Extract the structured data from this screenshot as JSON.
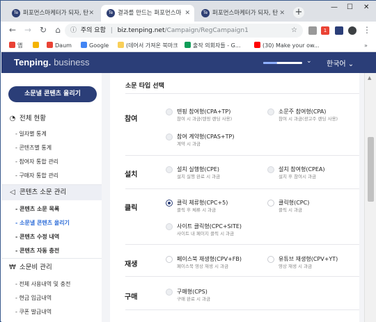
{
  "browser": {
    "tabs": [
      {
        "title": "퍼포먼스마케터가 되자, 탄",
        "fav": "Te"
      },
      {
        "title": "결과를 만드는 퍼포먼스마",
        "fav": "Te"
      },
      {
        "title": "퍼포먼스마케터가 되자, 탄",
        "fav": "Te"
      }
    ],
    "security_label": "주의 요함",
    "url_host": "biz.tenping.net",
    "url_path": "/Campaign/RegCampaign1",
    "bookmarks": [
      {
        "label": "앱",
        "color": "#e94235"
      },
      {
        "label": "",
        "color": "#f4b400"
      },
      {
        "label": "Daum",
        "color": "#ea4335"
      },
      {
        "label": "Google",
        "color": "#4285f4"
      },
      {
        "label": "(데어서 가져온 북마크",
        "color": "#f9cf58"
      },
      {
        "label": "출작 의회자들 - G...",
        "color": "#0f9d58"
      },
      {
        "label": "(30) Make your ow...",
        "color": "#ff0000"
      }
    ]
  },
  "header": {
    "logo": "Tenping.",
    "logo_suffix": "business",
    "language": "한국어"
  },
  "sidebar": {
    "upload_button": "소문낼 콘텐츠 올리기",
    "sections": [
      {
        "label": "전체 현황",
        "icon": "gauge-icon",
        "items": [
          "일자별 통계",
          "콘텐츠별 통계",
          "참여자 통합 관리",
          "구매자 통합 관리"
        ]
      },
      {
        "label": "콘텐츠 소문 관리",
        "icon": "megaphone-icon",
        "items": [
          "콘텐츠 소문 목록",
          "소문낼 콘텐츠 올리기",
          "콘텐츠 수정 내역",
          "콘텐츠 자동 충전"
        ]
      },
      {
        "label": "소문비 관리",
        "icon": "won-coin-icon",
        "items": [
          "전체 사용내역 및 충전",
          "현금 입금내역",
          "쿠폰 발급내역"
        ]
      }
    ]
  },
  "main": {
    "title": "소문 타입 선택",
    "categories": [
      {
        "name": "참여",
        "options": [
          {
            "label": "텐핑 참여형(CPA+TP)",
            "desc": "참여 시 과금(텐핑 랜딩 사용)",
            "state": "disabled"
          },
          {
            "label": "소문주 참여형(CPA)",
            "desc": "참여 시 과금(광고주 랜딩 사용)",
            "state": "disabled"
          },
          {
            "label": "참여 계약형(CPAS+TP)",
            "desc": "계약 시 과금",
            "state": "disabled"
          }
        ]
      },
      {
        "name": "설치",
        "options": [
          {
            "label": "설치 실행형(CPE)",
            "desc": "설치 실행 완료 시 과금",
            "state": "disabled"
          },
          {
            "label": "설치 참여형(CPEA)",
            "desc": "설치 후 참여시 과금",
            "state": "disabled"
          }
        ]
      },
      {
        "name": "클릭",
        "options": [
          {
            "label": "클릭 체류형(CPC+5)",
            "desc": "클릭 후 체류 시 과금",
            "state": "checked"
          },
          {
            "label": "클릭형(CPC)",
            "desc": "클릭 시 과금",
            "state": "unchecked"
          },
          {
            "label": "사이트 클릭형(CPC+SITE)",
            "desc": "사이트 내 페이지 클릭 시 과금",
            "state": "disabled"
          }
        ]
      },
      {
        "name": "재생",
        "options": [
          {
            "label": "페이스북 재생형(CPV+FB)",
            "desc": "페이스북 영상 재생 시 과금",
            "state": "unchecked"
          },
          {
            "label": "유튜브 재생형(CPV+YT)",
            "desc": "영상 재생 시 과금",
            "state": "unchecked"
          }
        ]
      },
      {
        "name": "구매",
        "options": [
          {
            "label": "구매형(CPS)",
            "desc": "구매 완료 시 과금",
            "state": "disabled"
          }
        ]
      }
    ]
  }
}
